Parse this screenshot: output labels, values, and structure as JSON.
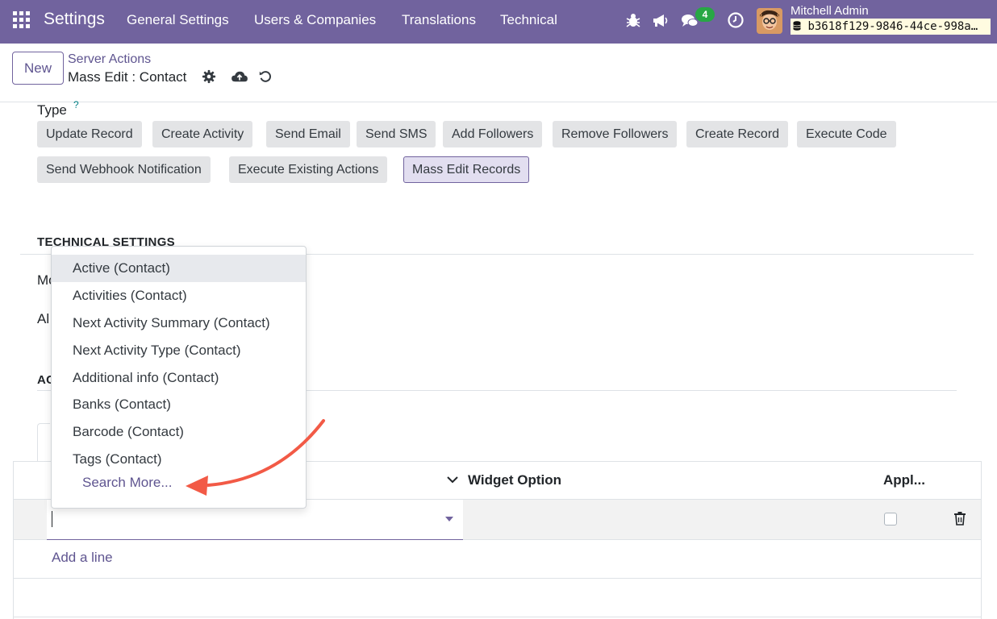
{
  "navbar": {
    "brand": "Settings",
    "menu": [
      "General Settings",
      "Users & Companies",
      "Translations",
      "Technical"
    ],
    "chat_count": "4",
    "user_name": "Mitchell Admin",
    "database": "b3618f129-9846-44ce-998a…",
    "icons": [
      "apps-grid-icon",
      "bug-icon",
      "megaphone-icon",
      "chat-icon",
      "clock-icon"
    ]
  },
  "control_panel": {
    "new_label": "New",
    "breadcrumb_parent": "Server Actions",
    "breadcrumb_current": "Mass Edit : Contact",
    "icons": [
      "gear-icon",
      "cloud-save-icon",
      "discard-icon"
    ]
  },
  "form": {
    "type_label": "Type",
    "type_help": "?",
    "type_options": [
      "Update Record",
      "Create Activity",
      "Send Email",
      "Send SMS",
      "Add Followers",
      "Remove Followers",
      "Create Record",
      "Execute Code",
      "Send Webhook Notification",
      "Execute Existing Actions",
      "Mass Edit Records"
    ],
    "type_selected": "Mass Edit Records",
    "technical_settings_title": "TECHNICAL SETTINGS",
    "partial_label_1": "Mo",
    "partial_label_2": "Al",
    "partial_section": "AC"
  },
  "table": {
    "col_widget_option": "Widget Option",
    "col_apply": "Appl...",
    "add_line": "Add a line"
  },
  "dropdown": {
    "items": [
      "Active (Contact)",
      "Activities (Contact)",
      "Next Activity Summary (Contact)",
      "Next Activity Type (Contact)",
      "Additional info (Contact)",
      "Banks (Contact)",
      "Barcode (Contact)",
      "Tags (Contact)"
    ],
    "highlighted": "Active (Contact)",
    "search_more": "Search More..."
  },
  "colors": {
    "navbar": "#71639e",
    "accent_text": "#5f5590",
    "annotation_arrow": "#f25a46",
    "badge": "#28a745"
  }
}
